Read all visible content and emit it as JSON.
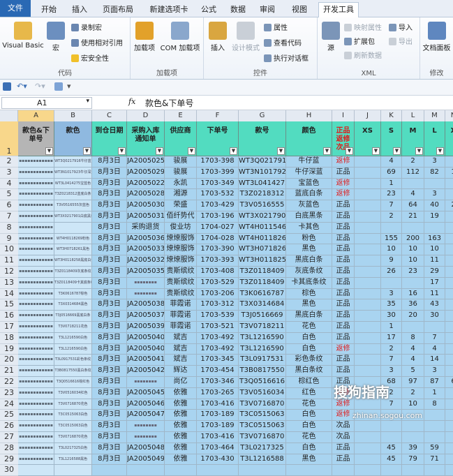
{
  "tabs": [
    "文件",
    "开始",
    "插入",
    "页面布局",
    "新建选项卡",
    "公式",
    "数据",
    "审阅",
    "视图",
    "开发工具"
  ],
  "ribbon": {
    "code_group": {
      "name": "代码",
      "visual_basic": "Visual Basic",
      "macro": "宏",
      "record_macro": "录制宏",
      "relative_ref": "使用相对引用",
      "macro_security": "宏安全性"
    },
    "addins_group": {
      "name": "加载项",
      "addins": "加载项",
      "com_addins": "COM 加载项"
    },
    "controls_group": {
      "name": "控件",
      "insert": "插入",
      "design_mode": "设计模式",
      "properties": "属性",
      "view_code": "查看代码",
      "run_dialog": "执行对话框"
    },
    "xml_group": {
      "name": "XML",
      "source": "源",
      "map_properties": "映射属性",
      "expansion_packs": "扩展包",
      "refresh_data": "刷新数据",
      "import": "导入",
      "export": "导出"
    },
    "modify_group": {
      "name": "修改",
      "doc_panel": "文档面板"
    }
  },
  "formula_bar": {
    "name_box": "A1",
    "fx": "fx",
    "formula": "款色&下单号"
  },
  "columns": [
    "A",
    "B",
    "C",
    "D",
    "E",
    "F",
    "G",
    "H",
    "I",
    "J",
    "K",
    "L",
    "M",
    "N"
  ],
  "headers": [
    "款色&下单号",
    "款色",
    "到仓日期",
    "采购入库通知单",
    "供应商",
    "下单号",
    "款号",
    "颜色",
    "正品返修次品",
    "XS",
    "S",
    "M",
    "L",
    "X"
  ],
  "rows": [
    {
      "n": "2",
      "a": "▪▪▪▪▪▪▪▪▪▪▪▪",
      "b": "WT3Q0217916牛仔蓝",
      "c": "8月3日",
      "d": "JA2005025",
      "e": "骏展",
      "f": "1703-398",
      "g": "WT3Q0217916",
      "h": "牛仔蓝",
      "i": "返修",
      "k": "4",
      "l": "2",
      "m": "3",
      "x": ""
    },
    {
      "n": "3",
      "a": "▪▪▪▪▪▪▪▪▪▪▪▪",
      "b": "WT3N1017923牛仔深蓝",
      "c": "8月3日",
      "d": "JA2005029",
      "e": "骏展",
      "f": "1703-399",
      "g": "WT3N1017923",
      "h": "牛仔深蓝",
      "i": "正品",
      "k": "69",
      "l": "112",
      "m": "82",
      "x": "1"
    },
    {
      "n": "4",
      "a": "▪▪▪▪▪▪▪▪▪▪▪▪",
      "b": "WT3L0414275宝蓝色",
      "c": "8月3日",
      "d": "JA2005022",
      "e": "永凯",
      "f": "1703-349",
      "g": "WT3L0414275",
      "h": "宝蓝色",
      "i": "返修",
      "k": "1",
      "l": "",
      "m": "",
      "x": ""
    },
    {
      "n": "5",
      "a": "▪▪▪▪▪▪▪▪▪▪▪▪",
      "b": "T3Z0218312蓝底白条",
      "c": "8月3日",
      "d": "JA2005028",
      "e": "湘源",
      "f": "1703-532",
      "g": "T3Z0218312",
      "h": "蓝底白条",
      "i": "返修",
      "k": "23",
      "l": "4",
      "m": "3",
      "x": ""
    },
    {
      "n": "6",
      "a": "▪▪▪▪▪▪▪▪▪▪▪▪",
      "b": "T3V0516555灰蓝色",
      "c": "8月3日",
      "d": "JA2005030",
      "e": "荣盛",
      "f": "1703-429",
      "g": "T3V0516555",
      "h": "灰蓝色",
      "i": "正品",
      "k": "7",
      "l": "64",
      "m": "40",
      "x": "2"
    },
    {
      "n": "7",
      "a": "▪▪▪▪▪▪▪▪▪▪▪▪",
      "b": "WT3X0217901白底黑条",
      "c": "8月3日",
      "d": "JA2005031",
      "e": "佰纤势代",
      "f": "1703-196",
      "g": "WT3X0217901",
      "h": "白底黑条",
      "i": "正品",
      "k": "2",
      "l": "21",
      "m": "19",
      "x": ""
    },
    {
      "n": "8",
      "a": "▪▪▪▪▪▪▪▪▪▪▪▪",
      "b": "",
      "c": "8月3日",
      "d": "采购退货",
      "e": "俊业坊",
      "f": "1704-027",
      "g": "WT4H0115462",
      "h": "卡其色",
      "i": "正品",
      "k": "",
      "l": "",
      "m": "",
      "x": ""
    },
    {
      "n": "9",
      "a": "▪▪▪▪▪▪▪▪▪▪▪▪",
      "b": "WT4H0118269粉色",
      "c": "8月3日",
      "d": "JA2005036",
      "e": "燎燎服饰",
      "f": "1704-028",
      "g": "WT4H0118269",
      "h": "粉色",
      "i": "正品",
      "k": "155",
      "l": "200",
      "m": "163",
      "x": ""
    },
    {
      "n": "10",
      "a": "▪▪▪▪▪▪▪▪▪▪▪▪",
      "b": "WT3H0718261黑色",
      "c": "8月3日",
      "d": "JA2005033",
      "e": "燎燎服饰",
      "f": "1703-390",
      "g": "WT3H0718261",
      "h": "黑色",
      "i": "正品",
      "k": "10",
      "l": "10",
      "m": "10",
      "x": ""
    },
    {
      "n": "11",
      "a": "▪▪▪▪▪▪▪▪▪▪▪▪",
      "b": "WT3H0118258黑底白条",
      "c": "8月3日",
      "d": "JA2005032",
      "e": "燎燎服饰",
      "f": "1703-393",
      "g": "WT3H0118258",
      "h": "黑底白条",
      "i": "正品",
      "k": "9",
      "l": "10",
      "m": "11",
      "x": ""
    },
    {
      "n": "12",
      "a": "▪▪▪▪▪▪▪▪▪▪▪▪",
      "b": "T3Z0118409灰底条纹",
      "c": "8月3日",
      "d": "JA2005035",
      "e": "贵斯缤纹",
      "f": "1703-408",
      "g": "T3Z0118409",
      "h": "灰底条纹",
      "i": "正品",
      "k": "26",
      "l": "23",
      "m": "29",
      "x": ""
    },
    {
      "n": "13",
      "a": "▪▪▪▪▪▪▪▪▪▪▪▪",
      "b": "T3Z0118409卡其底条纹",
      "c": "8月3日",
      "d": "▪▪▪▪▪▪▪▪",
      "e": "贵斯缤纹",
      "f": "1703-529",
      "g": "T3Z0118409",
      "h": "卡其底条纹",
      "i": "正品",
      "k": "",
      "l": "",
      "m": "17",
      "x": ""
    },
    {
      "n": "14",
      "a": "▪▪▪▪▪▪▪▪▪▪▪▪",
      "b": "T3K0616787棕色",
      "c": "8月3日",
      "d": "▪▪▪▪▪▪▪▪",
      "e": "贵斯缤纹",
      "f": "1703-206",
      "g": "T3K0616787",
      "h": "棕色",
      "i": "正品",
      "k": "3",
      "l": "16",
      "m": "11",
      "x": ""
    },
    {
      "n": "15",
      "a": "▪▪▪▪▪▪▪▪▪▪▪▪",
      "b": "T3X0314684黑色",
      "c": "8月3日",
      "d": "JA2005038",
      "e": "菲霞诺",
      "f": "1703-312",
      "g": "T3X0314684",
      "h": "黑色",
      "i": "正品",
      "k": "35",
      "l": "36",
      "m": "43",
      "x": ""
    },
    {
      "n": "16",
      "a": "▪▪▪▪▪▪▪▪▪▪▪▪",
      "b": "T3J0516669黑底白条",
      "c": "8月3日",
      "d": "JA2005037",
      "e": "菲霞诺",
      "f": "1703-539",
      "g": "T3J0516669",
      "h": "黑底白条",
      "i": "正品",
      "k": "30",
      "l": "20",
      "m": "30",
      "x": ""
    },
    {
      "n": "17",
      "a": "▪▪▪▪▪▪▪▪▪▪▪▪",
      "b": "T3V0718211花色",
      "c": "8月3日",
      "d": "JA2005039",
      "e": "菲霞诺",
      "f": "1703-521",
      "g": "T3V0718211",
      "h": "花色",
      "i": "正品",
      "k": "1",
      "l": "",
      "m": "",
      "x": ""
    },
    {
      "n": "18",
      "a": "▪▪▪▪▪▪▪▪▪▪▪▪",
      "b": "T3L1216590白色",
      "c": "8月3日",
      "d": "JA2005040",
      "e": "斌吉",
      "f": "1703-492",
      "g": "T3L1216590",
      "h": "白色",
      "i": "正品",
      "k": "17",
      "l": "8",
      "m": "7",
      "x": ""
    },
    {
      "n": "19",
      "a": "▪▪▪▪▪▪▪▪▪▪▪▪",
      "b": "T3L1216590白色",
      "c": "8月3日",
      "d": "JA2005040",
      "e": "斌吉",
      "f": "1703-492",
      "g": "T3L1216590",
      "h": "白色",
      "i": "返修",
      "k": "2",
      "l": "4",
      "m": "4",
      "x": ""
    },
    {
      "n": "20",
      "a": "▪▪▪▪▪▪▪▪▪▪▪▪",
      "b": "T3L0917531彩色条纹",
      "c": "8月3日",
      "d": "JA2005041",
      "e": "斌吉",
      "f": "1703-345",
      "g": "T3L0917531",
      "h": "彩色条纹",
      "i": "正品",
      "k": "7",
      "l": "4",
      "m": "14",
      "x": ""
    },
    {
      "n": "21",
      "a": "▪▪▪▪▪▪▪▪▪▪▪▪",
      "b": "T3B0817550黑白条纹",
      "c": "8月3日",
      "d": "JA2005042",
      "e": "辉达",
      "f": "1703-454",
      "g": "T3B0817550",
      "h": "黑白条纹",
      "i": "正品",
      "k": "3",
      "l": "5",
      "m": "3",
      "x": ""
    },
    {
      "n": "22",
      "a": "▪▪▪▪▪▪▪▪▪▪▪▪",
      "b": "T3Q0516616棕红色",
      "c": "8月3日",
      "d": "▪▪▪▪▪▪▪▪",
      "e": "尚亿",
      "f": "1703-346",
      "g": "T3Q0516616",
      "h": "棕红色",
      "i": "正品",
      "k": "68",
      "l": "97",
      "m": "87",
      "x": "6"
    },
    {
      "n": "23",
      "a": "▪▪▪▪▪▪▪▪▪▪▪▪",
      "b": "T3V0516034红色",
      "c": "8月3日",
      "d": "JA2005045",
      "e": "依雅",
      "f": "1703-265",
      "g": "T3V0516034",
      "h": "红色",
      "i": "返修",
      "k": "2",
      "l": "2",
      "m": "1",
      "x": ""
    },
    {
      "n": "24",
      "a": "▪▪▪▪▪▪▪▪▪▪▪▪",
      "b": "T3V0716870花色",
      "c": "8月3日",
      "d": "JA2005046",
      "e": "依雅",
      "f": "1703-416",
      "g": "T3V0716870",
      "h": "花色",
      "i": "返修",
      "k": "7",
      "l": "10",
      "m": "8",
      "x": ""
    },
    {
      "n": "25",
      "a": "▪▪▪▪▪▪▪▪▪▪▪▪",
      "b": "T3C0515063白色",
      "c": "8月3日",
      "d": "JA2005047",
      "e": "依雅",
      "f": "1703-189",
      "g": "T3C0515063",
      "h": "白色",
      "i": "返修",
      "k": "",
      "l": "",
      "m": "",
      "x": ""
    },
    {
      "n": "26",
      "a": "▪▪▪▪▪▪▪▪▪▪▪▪",
      "b": "T3C0515063白色",
      "c": "8月3日",
      "d": "▪▪▪▪▪▪▪▪",
      "e": "依雅",
      "f": "1703-189",
      "g": "T3C0515063",
      "h": "白色",
      "i": "次品",
      "k": "",
      "l": "",
      "m": "",
      "x": ""
    },
    {
      "n": "27",
      "a": "▪▪▪▪▪▪▪▪▪▪▪▪",
      "b": "T3V0716870花色",
      "c": "8月3日",
      "d": "▪▪▪▪▪▪▪▪",
      "e": "依雅",
      "f": "1703-416",
      "g": "T3V0716870",
      "h": "花色",
      "i": "次品",
      "k": "",
      "l": "",
      "m": "",
      "x": ""
    },
    {
      "n": "28",
      "a": "▪▪▪▪▪▪▪▪▪▪▪▪",
      "b": "T3L0217325白色",
      "c": "8月3日",
      "d": "JA2005048",
      "e": "依雅",
      "f": "1703-464",
      "g": "T3L0217325",
      "h": "白色",
      "i": "正品",
      "k": "45",
      "l": "39",
      "m": "59",
      "x": ""
    },
    {
      "n": "29",
      "a": "▪▪▪▪▪▪▪▪▪▪▪▪",
      "b": "T3L1216588黑色",
      "c": "8月3日",
      "d": "JA2005049",
      "e": "依雅",
      "f": "1703-430",
      "g": "T3L1216588",
      "h": "黑色",
      "i": "正品",
      "k": "45",
      "l": "79",
      "m": "71",
      "x": ""
    },
    {
      "n": "30",
      "a": "",
      "b": "",
      "c": "",
      "d": "",
      "e": "",
      "f": "",
      "g": "",
      "h": "",
      "i": "",
      "k": "",
      "l": "",
      "m": "",
      "x": ""
    }
  ],
  "watermark": {
    "brand": "搜狗指南",
    "url": "zhinan.sogou.com"
  },
  "colors": {
    "header_teal": "#52dcc0",
    "cell_blue": "#a9d4f0",
    "cell_lightblue": "#cde6f7",
    "red": "#e01a1a",
    "tab_blue": "#2a69b4"
  }
}
